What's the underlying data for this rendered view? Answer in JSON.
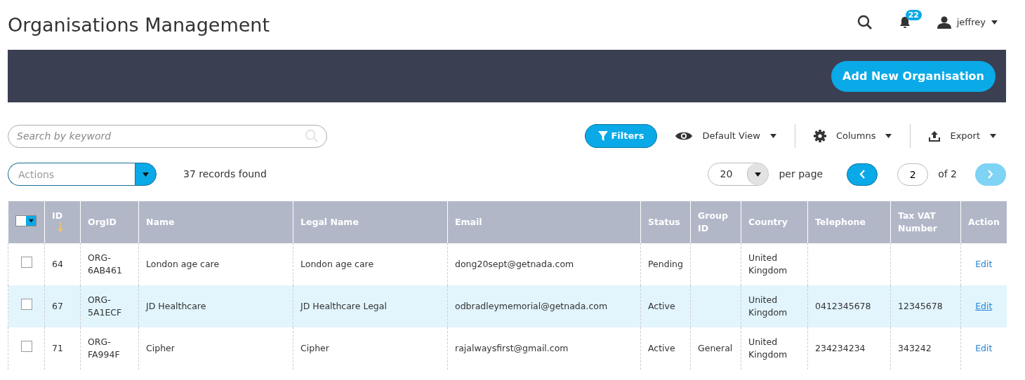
{
  "page_title": "Organisations Management",
  "header": {
    "notification_count": "22",
    "user_name": "jeffrey"
  },
  "add_button": "Add New Organisation",
  "search": {
    "placeholder": "Search by keyword"
  },
  "toolbar": {
    "filters": "Filters",
    "view": "Default View",
    "columns": "Columns",
    "export": "Export"
  },
  "actions": {
    "placeholder": "Actions"
  },
  "records_found": "37 records found",
  "pagination": {
    "per_page_value": "20",
    "per_page_label": "per page",
    "page": "2",
    "of_pages": "of 2",
    "prev_disabled": false,
    "next_disabled": true
  },
  "table": {
    "select_all": {
      "checked": false
    },
    "columns": [
      {
        "label": "ID",
        "sorted": true
      },
      {
        "label": "OrgID",
        "sorted": false
      },
      {
        "label": "Name",
        "sorted": false
      },
      {
        "label": "Legal Name",
        "sorted": false
      },
      {
        "label": "Email",
        "sorted": false
      },
      {
        "label": "Status",
        "sorted": false
      },
      {
        "label": "Group ID",
        "sorted": false
      },
      {
        "label": "Country",
        "sorted": false
      },
      {
        "label": "Telephone",
        "sorted": false
      },
      {
        "label": "Tax VAT Number",
        "sorted": false
      },
      {
        "label": "Action",
        "sorted": false
      }
    ],
    "rows": [
      {
        "checked": false,
        "highlighted": false,
        "cells": [
          "64",
          "ORG-6AB461",
          "London age care",
          "London age care",
          "dong20sept@getnada.com",
          "Pending",
          "",
          "United Kingdom",
          "",
          ""
        ],
        "action": "Edit"
      },
      {
        "checked": false,
        "highlighted": true,
        "cells": [
          "67",
          "ORG-5A1ECF",
          "JD Healthcare",
          "JD Healthcare Legal",
          "odbradleymemorial@getnada.com",
          "Active",
          "",
          "United Kingdom",
          "0412345678",
          "12345678"
        ],
        "action": "Edit"
      },
      {
        "checked": false,
        "highlighted": false,
        "cells": [
          "71",
          "ORG-FA994F",
          "Cipher",
          "Cipher",
          "rajalwaysfirst@gmail.com",
          "Active",
          "General",
          "United Kingdom",
          "234234234",
          "343242"
        ],
        "action": "Edit"
      }
    ]
  }
}
